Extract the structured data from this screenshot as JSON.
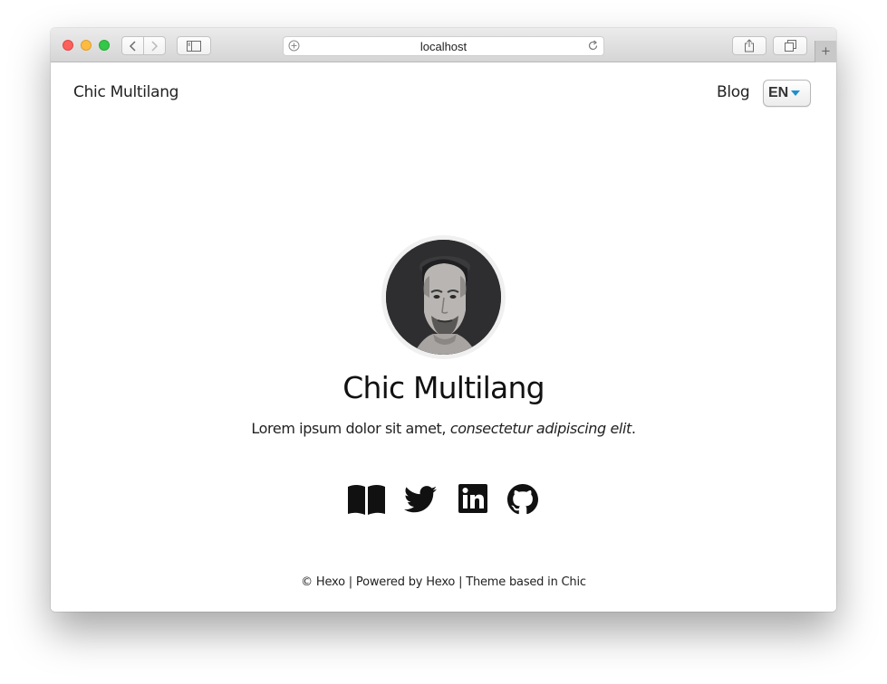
{
  "browser": {
    "url": "localhost"
  },
  "site": {
    "title": "Chic Multilang",
    "nav": {
      "blog_label": "Blog"
    },
    "language": {
      "selected": "EN"
    }
  },
  "profile": {
    "name": "Chic Multilang",
    "description_plain": "Lorem ipsum dolor sit amet, ",
    "description_italic": "consectetur adipiscing elit",
    "description_end": "."
  },
  "social": {
    "icons": [
      "book-icon",
      "twitter-icon",
      "linkedin-icon",
      "github-icon"
    ]
  },
  "footer": {
    "text": "© Hexo | Powered by Hexo | Theme based in Chic"
  },
  "colors": {
    "accent": "#1d8fd0",
    "text": "#111111",
    "avatar_ring": "#f0f0f0"
  }
}
